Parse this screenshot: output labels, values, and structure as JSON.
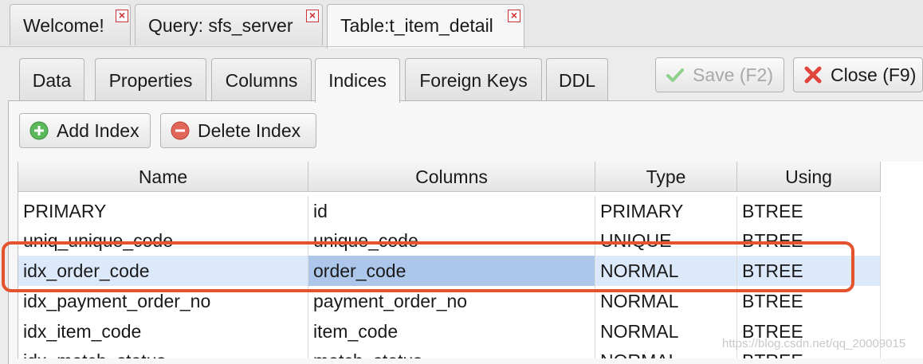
{
  "doc_tabs": [
    {
      "label": "Welcome!"
    },
    {
      "label": "Query: sfs_server"
    },
    {
      "label": "Table:t_item_detail"
    }
  ],
  "sub_tabs": [
    {
      "label": "Data"
    },
    {
      "label": "Properties"
    },
    {
      "label": "Columns"
    },
    {
      "label": "Indices"
    },
    {
      "label": "Foreign Keys"
    },
    {
      "label": "DDL"
    }
  ],
  "active_sub_tab": "Indices",
  "actions": {
    "save_label": "Save (F2)",
    "close_label": "Close (F9)"
  },
  "toolbar": {
    "add_label": "Add Index",
    "delete_label": "Delete Index"
  },
  "table": {
    "headers": [
      "Name",
      "Columns",
      "Type",
      "Using"
    ],
    "rows": [
      [
        "PRIMARY",
        "id",
        "PRIMARY",
        "BTREE"
      ],
      [
        "uniq_unique_code",
        "unique_code",
        "UNIQUE",
        "BTREE"
      ],
      [
        "idx_order_code",
        "order_code",
        "NORMAL",
        "BTREE"
      ],
      [
        "idx_payment_order_no",
        "payment_order_no",
        "NORMAL",
        "BTREE"
      ],
      [
        "idx_item_code",
        "item_code",
        "NORMAL",
        "BTREE"
      ],
      [
        "idx_match_status",
        "match_status",
        "NORMAL",
        "BTREE"
      ]
    ],
    "selected_row": 2
  },
  "watermark": "https://blog.csdn.net/qq_20009015",
  "colors": {
    "highlight": "#e3532e",
    "selection": "#dce9fb",
    "focus_cell": "#adc7ea"
  }
}
